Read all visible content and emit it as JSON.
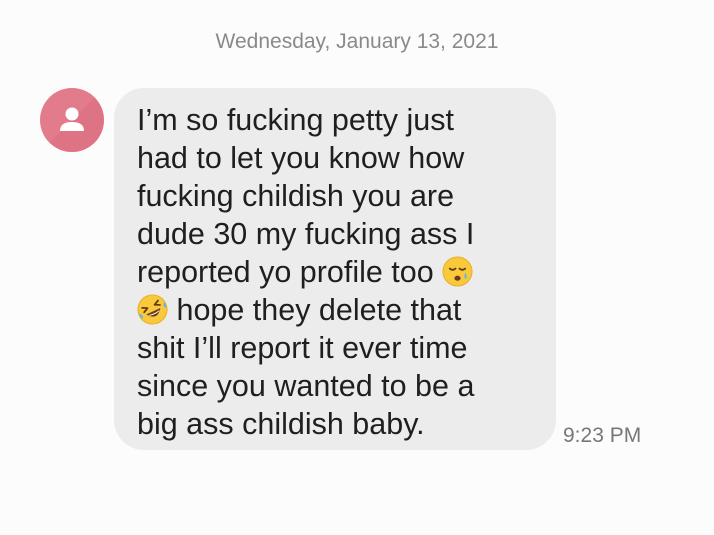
{
  "conversation": {
    "date_header": "Wednesday, January 13, 2021"
  },
  "message": {
    "lines": [
      "I’m so fucking petty just",
      "had to let you know how",
      "fucking childish you are",
      "dude 30 my fucking ass I",
      "reported yo profile too",
      "hope they delete that",
      "shit I’ll report it ever time",
      "since you wanted to be a",
      "big ass childish baby."
    ],
    "emojis": [
      "sleepy-face-emoji",
      "rolling-on-floor-laughing-emoji"
    ],
    "time": "9:23 PM"
  },
  "sender": {
    "avatar_icon": "person-icon",
    "avatar_color": "#e27c8c"
  }
}
